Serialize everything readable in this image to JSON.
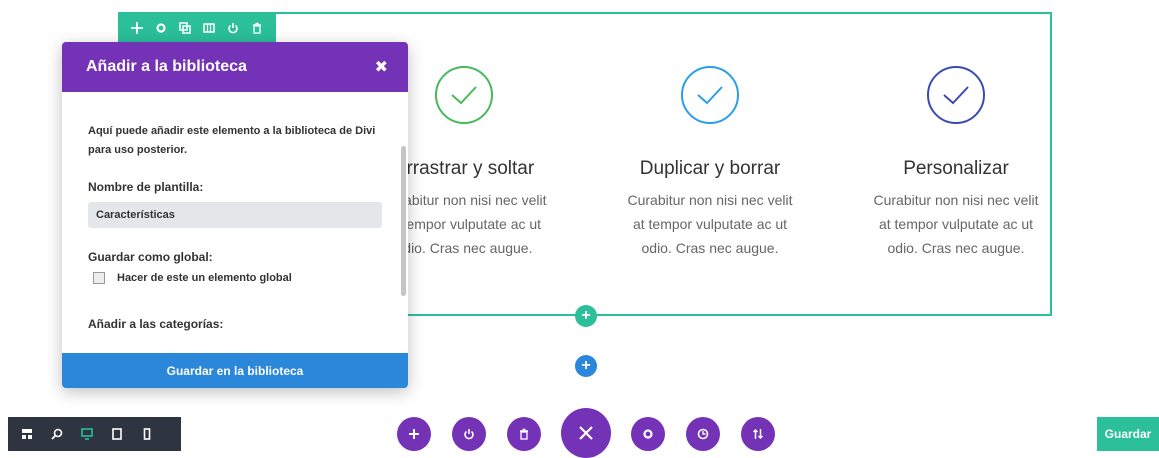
{
  "row_toolbar": {
    "icons": [
      "move-icon",
      "gear-icon",
      "duplicate-icon",
      "columns-icon",
      "power-icon",
      "trash-icon"
    ]
  },
  "columns": [
    {
      "title": "Arrastrar y soltar",
      "lines": [
        "Curabitur non nisi nec velit",
        "at tempor vulputate ac ut",
        "odio. Cras nec augue."
      ],
      "color": "#49b957"
    },
    {
      "title": "Duplicar y borrar",
      "lines": [
        "Curabitur non nisi nec velit",
        "at tempor vulputate ac ut",
        "odio. Cras nec augue."
      ],
      "color": "#2b9ee9"
    },
    {
      "title": "Personalizar",
      "lines": [
        "Curabitur non nisi nec velit",
        "at tempor vulputate ac ut",
        "odio. Cras nec augue."
      ],
      "color": "#3a4bb3"
    }
  ],
  "modal": {
    "title": "Añadir a la biblioteca",
    "description": "Aquí puede añadir este elemento a la biblioteca de Divi para uso posterior.",
    "template_name_label": "Nombre de plantilla:",
    "template_name_value": "Características",
    "global_label": "Guardar como global:",
    "global_checkbox_label": "Hacer de este un elemento global",
    "categories_label": "Añadir a las categorías:",
    "save_button": "Guardar en la biblioteca"
  },
  "bottom_bar": {
    "save_button": "Guardar"
  },
  "colors": {
    "teal": "#2bbf9a",
    "purple": "#7432b7",
    "blue": "#2b87da"
  }
}
